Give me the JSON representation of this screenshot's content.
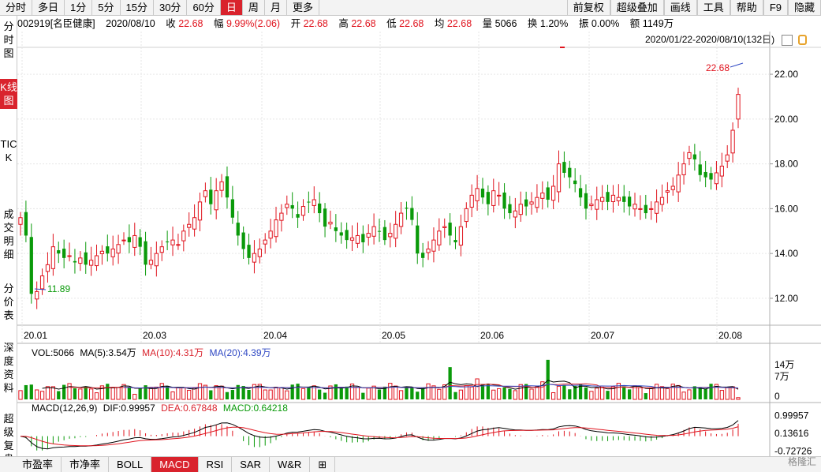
{
  "toolbar": {
    "left": [
      "分时",
      "多日",
      "1分",
      "5分",
      "15分",
      "30分",
      "60分",
      "日",
      "周",
      "月",
      "更多"
    ],
    "active_index": 7,
    "right": [
      "前复权",
      "超级叠加",
      "画线",
      "工具",
      "帮助",
      "F9",
      "隐藏"
    ]
  },
  "info": {
    "code": "002919[名臣健康]",
    "date": "2020/08/10",
    "close_label": "收",
    "close": "22.68",
    "range_label": "幅",
    "range": "9.99%(2.06)",
    "open_label": "开",
    "open": "22.68",
    "high_label": "高",
    "high": "22.68",
    "low_label": "低",
    "low": "22.68",
    "avg_label": "均",
    "avg": "22.68",
    "vol_label": "量",
    "vol": "5066",
    "turnover_label": "换",
    "turnover": "1.20%",
    "amp_label": "振",
    "amp": "0.00%",
    "amount_label": "额",
    "amount": "1149万"
  },
  "range_text": "2020/01/22-2020/08/10(132日)",
  "lefttabs": [
    "分时图",
    "K线图",
    "TICK",
    "成交明细",
    "分价表",
    "深度资料",
    "超级复盘"
  ],
  "colors": {
    "up": "#e0141e",
    "down": "#0a9a0a",
    "accent": "#d9232d",
    "ma5": "#000000",
    "ma10": "#d9232d",
    "ma20": "#3049c4"
  },
  "chart_data": {
    "type": "candlestick",
    "price_ticks": [
      "22.00",
      "20.00",
      "18.00",
      "16.00",
      "14.00",
      "12.00"
    ],
    "price_tick_values": [
      22,
      20,
      18,
      16,
      14,
      12
    ],
    "ylim": [
      10.8,
      23.2
    ],
    "x_labels": [
      "20.01",
      "20.03",
      "20.04",
      "20.05",
      "20.06",
      "20.07",
      "20.08"
    ],
    "high_annotation": "22.68",
    "low_annotation": "11.89",
    "volume": {
      "legend": [
        "VOL:5066",
        "MA(5):3.54万",
        "MA(10):4.31万",
        "MA(20):4.39万"
      ],
      "ticks": [
        "14万",
        "7万",
        "0"
      ]
    },
    "macd": {
      "legend": [
        "MACD(12,26,9)",
        "DIF:0.99957",
        "DEA:0.67848",
        "MACD:0.64218"
      ],
      "ticks": [
        "0.99957",
        "0.13616",
        "-0.72726"
      ]
    }
  },
  "bottomtabs": [
    "市盈率",
    "市净率",
    "BOLL",
    "MACD",
    "RSI",
    "SAR",
    "W&R",
    "⊞"
  ],
  "bottom_active_index": 3,
  "watermark": "格隆汇"
}
